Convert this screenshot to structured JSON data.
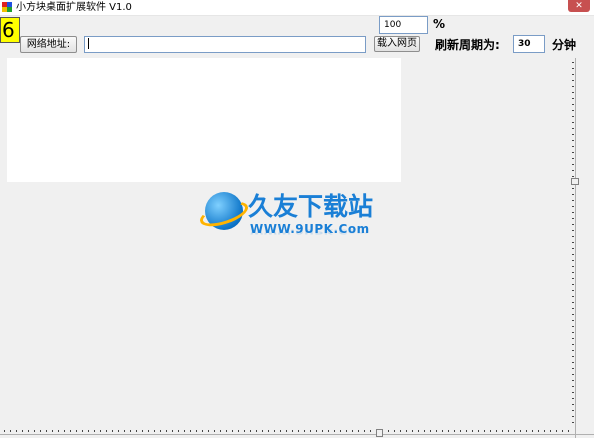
{
  "window": {
    "title": "小方块桌面扩展软件 V1.0",
    "close_glyph": "✕"
  },
  "counter": {
    "value": "6"
  },
  "toolbar": {
    "network_button": "网络地址:",
    "url_value": "",
    "load_button": "载入网页",
    "zoom_value": "100",
    "zoom_unit": "%",
    "refresh_label": "刷新周期为:",
    "refresh_value": "30",
    "refresh_unit": "分钟"
  },
  "watermark": {
    "name": "久友下载站",
    "url": "WWW.9UPK.Com"
  },
  "icons": {
    "app": "app-squares-icon",
    "close": "close-icon"
  },
  "colors": {
    "counter_bg": "#ffff00",
    "close_bg": "#c75050",
    "watermark_blue": "#1a7fd6",
    "watermark_orange": "#ffb300"
  }
}
